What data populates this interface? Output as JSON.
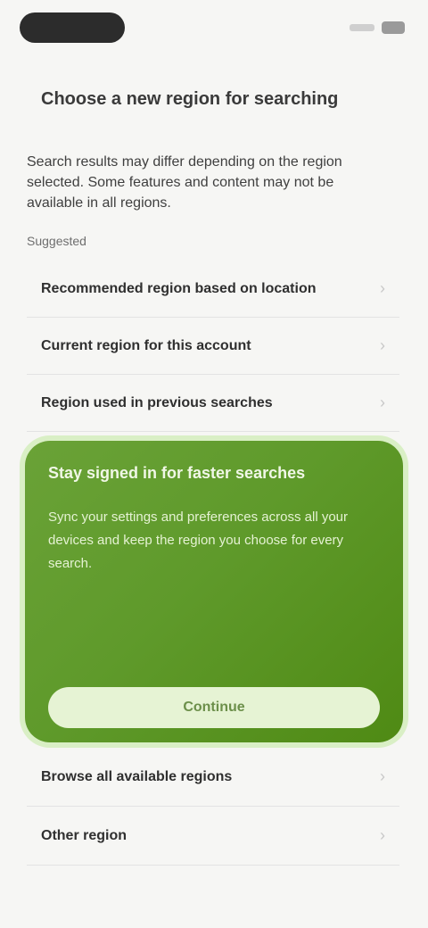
{
  "header": {
    "title": "Choose a new region for searching"
  },
  "intro": "Search results may differ depending on the region selected. Some features and content may not be available in all regions.",
  "section_label": "Suggested",
  "regions": [
    {
      "label": "Recommended region based on location"
    },
    {
      "label": "Current region for this account"
    },
    {
      "label": "Region used in previous searches"
    }
  ],
  "promo": {
    "title": "Stay signed in for faster searches",
    "body": "Sync your settings and preferences across all your devices and keep the region you choose for every search.",
    "button_label": "Continue"
  },
  "more_regions": [
    {
      "label": "Browse all available regions"
    },
    {
      "label": "Other region"
    }
  ],
  "colors": {
    "accent": "#5f9a2b",
    "accent_light": "#e6f3d4"
  }
}
